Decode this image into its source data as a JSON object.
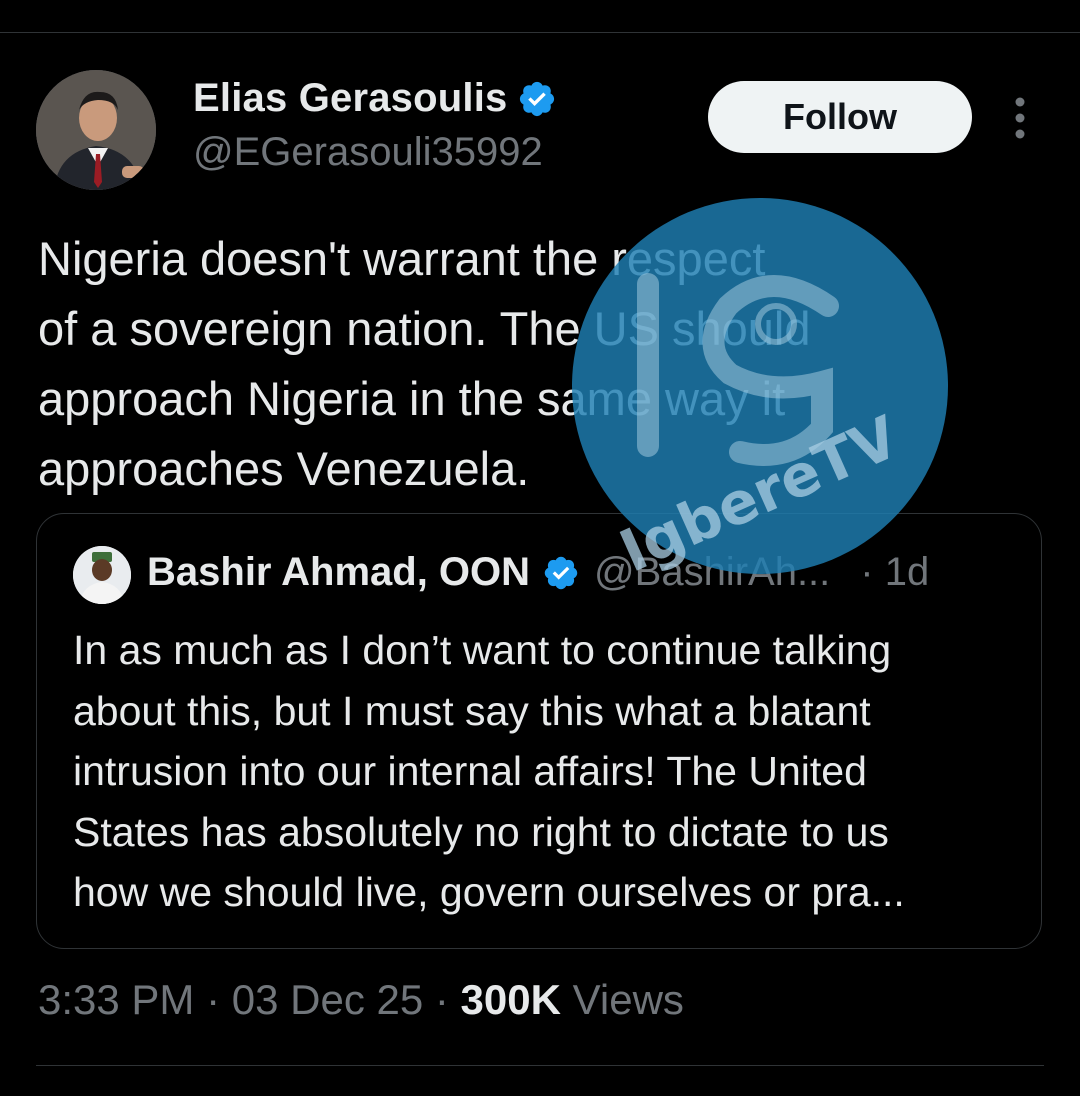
{
  "tweet": {
    "author": {
      "display_name": "Elias Gerasoulis",
      "handle": "@EGerasouli35992",
      "verified": true
    },
    "follow_label": "Follow",
    "text_lines": [
      "Nigeria doesn't warrant the respect",
      "of a sovereign nation. The US should",
      "approach Nigeria in the same way it",
      "approaches Venezuela."
    ],
    "quoted": {
      "display_name": "Bashir Ahmad, OON",
      "handle": "@BashirAh...",
      "time": "· 1d",
      "verified": true,
      "text_lines": [
        "In as much as I don’t want to continue talking",
        "about this, but I must say this what a blatant",
        "intrusion into our internal affairs! The United",
        "States has absolutely no right to dictate to us",
        "how we should live, govern ourselves or pra..."
      ]
    },
    "meta": {
      "time": "3:33 PM",
      "sep1": " · ",
      "date": "03 Dec 25",
      "sep2": " · ",
      "views_count": "300K",
      "views_label": " Views"
    }
  },
  "watermark": {
    "brand": "IgbereTV",
    "monogram": "IG",
    "color": "#1f7fb3"
  },
  "colors": {
    "background": "#000000",
    "text_primary": "#e7e9ea",
    "text_secondary": "#71767b",
    "verified_blue": "#1d9bf0",
    "follow_bg": "#eff3f4",
    "divider": "#2f3336"
  }
}
